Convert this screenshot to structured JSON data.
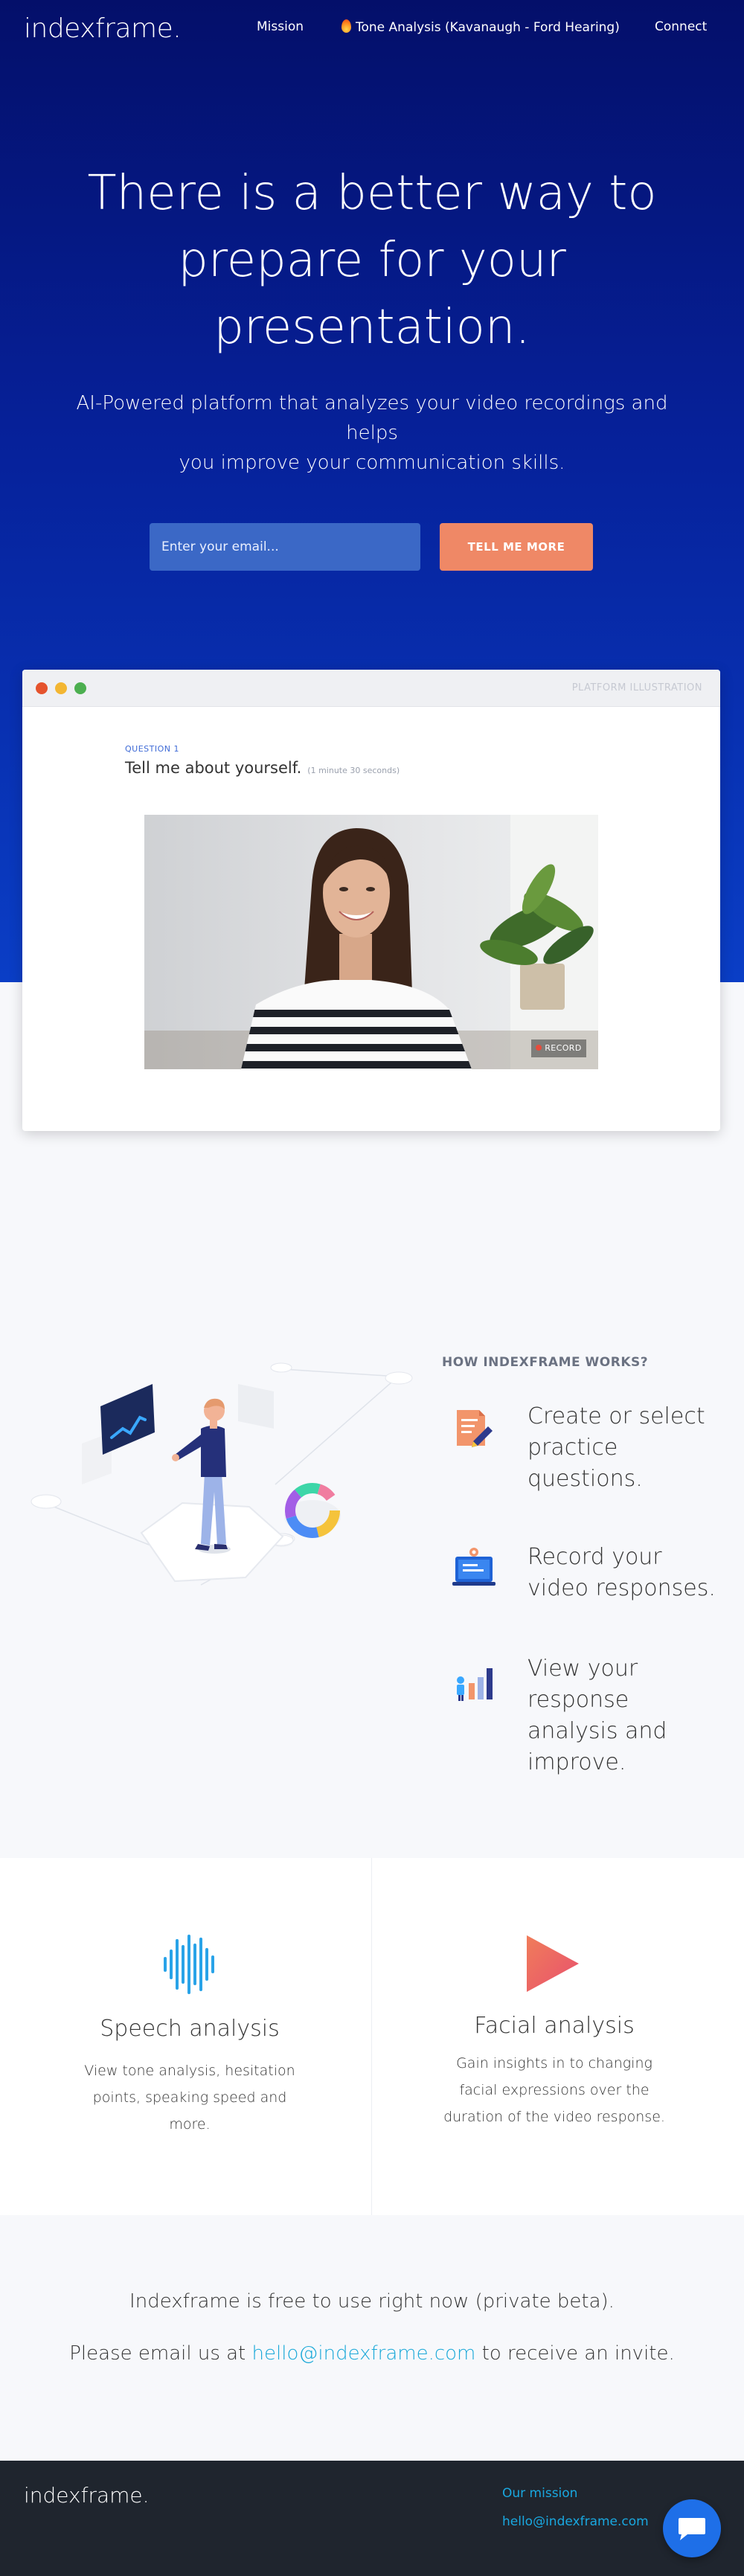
{
  "nav": {
    "logo": "indexframe.",
    "links": [
      {
        "label": "Mission"
      },
      {
        "label": "Tone Analysis (Kavanaugh - Ford Hearing)",
        "icon": "flame-icon"
      },
      {
        "label": "Connect"
      }
    ]
  },
  "hero": {
    "title_line1": "There is a better way to",
    "title_line2": "prepare for your",
    "title_line3": "presentation.",
    "subtitle_line1": "AI-Powered platform that analyzes your video recordings and helps",
    "subtitle_line2": "you improve your communication skills.",
    "email_placeholder": "Enter your email...",
    "cta_label": "TELL ME MORE"
  },
  "illustration_window": {
    "label": "PLATFORM ILLUSTRATION",
    "question_label": "QUESTION 1",
    "question_text": "Tell me about yourself.",
    "question_time": "(1 minute 30 seconds)",
    "record_label": "RECORD",
    "dot_colors": [
      "#e5532d",
      "#f3b632",
      "#4caf50"
    ]
  },
  "how_it_works": {
    "title": "HOW INDEXFRAME WORKS?",
    "steps": [
      {
        "icon": "document-edit-icon",
        "text": "Create or select practice questions."
      },
      {
        "icon": "laptop-record-icon",
        "text": "Record your video responses."
      },
      {
        "icon": "analysis-chart-icon",
        "text": "View your response analysis and improve."
      }
    ]
  },
  "features": [
    {
      "icon": "waveform-icon",
      "title": "Speech analysis",
      "desc_line1": "View tone analysis, hesitation",
      "desc_line2": "points, speaking speed and",
      "desc_line3": "more."
    },
    {
      "icon": "play-triangle-icon",
      "title": "Facial analysis",
      "desc_line1": "Gain insights in to changing",
      "desc_line2": "facial expressions over the",
      "desc_line3": "duration of the video response."
    }
  ],
  "beta": {
    "line1": "Indexframe is free to use right now (private beta).",
    "invite_prefix": "Please email us at",
    "invite_email": "hello@indexframe.com",
    "invite_suffix": "to receive an invite."
  },
  "footer": {
    "logo": "indexframe.",
    "mission_link": "Our mission",
    "email_link": "hello@indexframe.com"
  },
  "colors": {
    "hero_top": "#040f6a",
    "hero_bottom": "#0a3ec6",
    "cta": "#ef8866",
    "link": "#19a8d8",
    "footer_bg": "#1f252e",
    "chat_button": "#1e6fe8"
  }
}
